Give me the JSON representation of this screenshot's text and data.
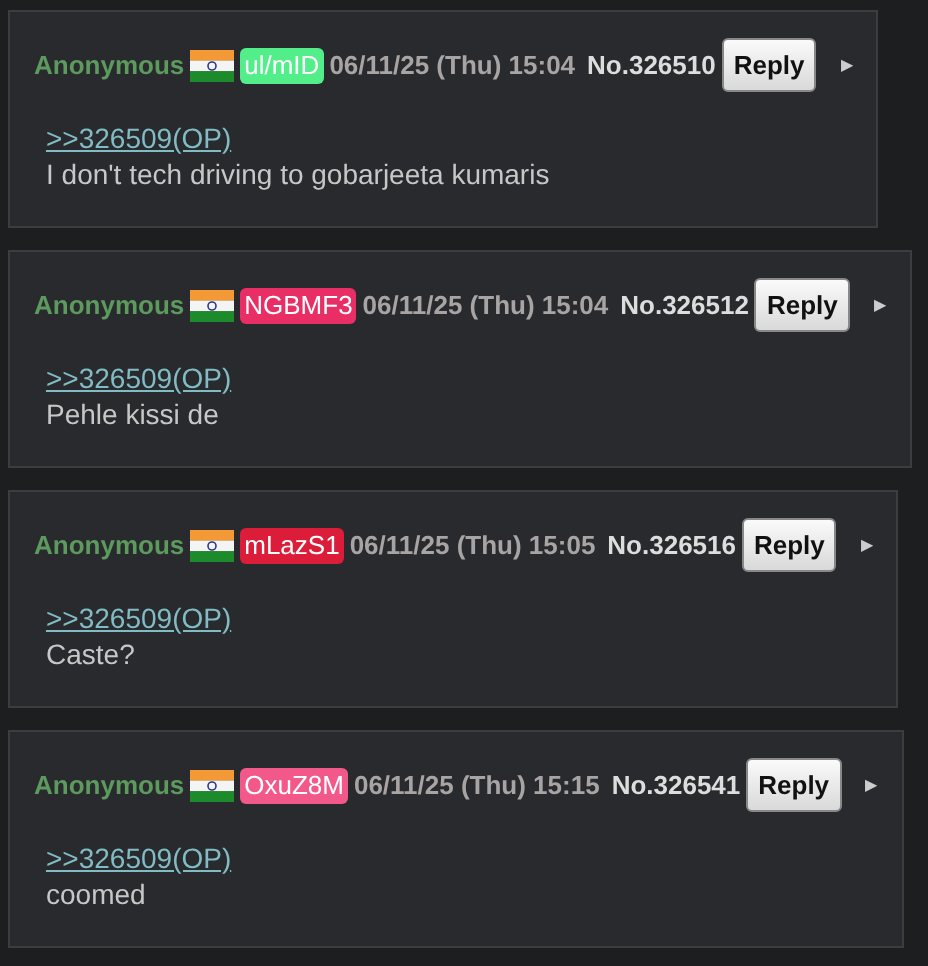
{
  "posts": [
    {
      "name": "Anonymous",
      "id": "ul/mID",
      "color": "#52ee8a",
      "date": "06/11/25 (Thu) 15:04",
      "number": "No.326510",
      "reply": "Reply",
      "menu": "▶",
      "quote": ">>326509(OP)",
      "text": "I don't tech driving to gobarjeeta kumaris"
    },
    {
      "name": "Anonymous",
      "id": "NGBMF3",
      "color": "#e92e66",
      "date": "06/11/25 (Thu) 15:04",
      "number": "No.326512",
      "reply": "Reply",
      "menu": "▶",
      "quote": ">>326509(OP)",
      "text": "Pehle kissi de"
    },
    {
      "name": "Anonymous",
      "id": "mLazS1",
      "color": "#dc1d3a",
      "date": "06/11/25 (Thu) 15:05",
      "number": "No.326516",
      "reply": "Reply",
      "menu": "▶",
      "quote": ">>326509(OP)",
      "text": "Caste?"
    },
    {
      "name": "Anonymous",
      "id": "OxuZ8M",
      "color": "#f2588a",
      "date": "06/11/25 (Thu) 15:15",
      "number": "No.326541",
      "reply": "Reply",
      "menu": "▶",
      "quote": ">>326509(OP)",
      "text": "coomed"
    }
  ]
}
